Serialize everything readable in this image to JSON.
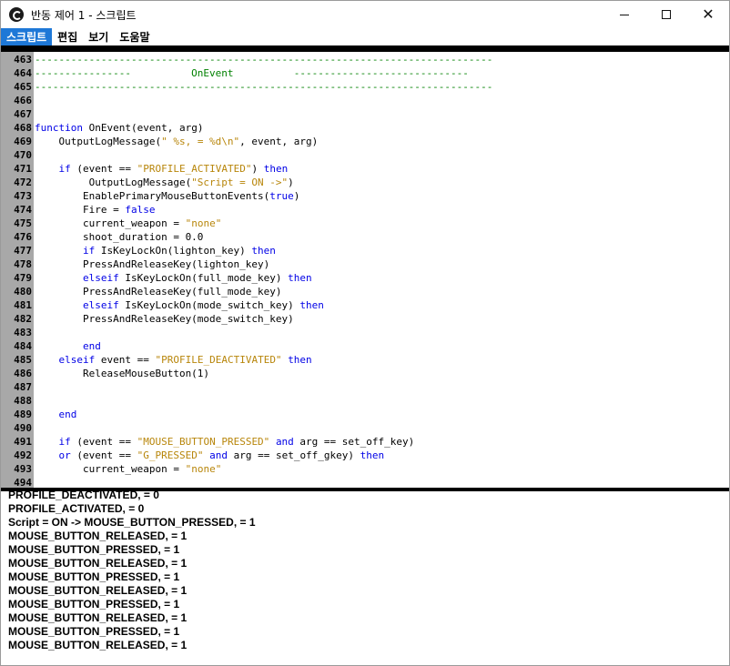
{
  "window": {
    "title": "반동 제어 1 - 스크립트"
  },
  "controls": {
    "minimize": "—",
    "maximize": "☐",
    "close": "✕"
  },
  "menu": [
    {
      "label": "스크립트",
      "active": true
    },
    {
      "label": "편집",
      "active": false
    },
    {
      "label": "보기",
      "active": false
    },
    {
      "label": "도움말",
      "active": false
    }
  ],
  "editor": {
    "lines": [
      {
        "n": "463",
        "segs": [
          [
            "cm",
            "----------------------------------------------------------------------------"
          ]
        ]
      },
      {
        "n": "464",
        "segs": [
          [
            "cm",
            "----------------          OnEvent          -----------------------------"
          ]
        ]
      },
      {
        "n": "465",
        "segs": [
          [
            "cm",
            "----------------------------------------------------------------------------"
          ]
        ]
      },
      {
        "n": "466",
        "segs": []
      },
      {
        "n": "467",
        "segs": []
      },
      {
        "n": "468",
        "segs": [
          [
            "kw",
            "function"
          ],
          [
            "",
            " OnEvent(event, arg)"
          ]
        ]
      },
      {
        "n": "469",
        "segs": [
          [
            "",
            "    OutputLogMessage("
          ],
          [
            "str",
            "\" %s, = %d\\n\""
          ],
          [
            "",
            ", event, arg)"
          ]
        ]
      },
      {
        "n": "470",
        "segs": []
      },
      {
        "n": "471",
        "segs": [
          [
            "",
            "    "
          ],
          [
            "kw",
            "if"
          ],
          [
            "",
            " (event == "
          ],
          [
            "str",
            "\"PROFILE_ACTIVATED\""
          ],
          [
            "",
            ") "
          ],
          [
            "kw",
            "then"
          ]
        ]
      },
      {
        "n": "472",
        "segs": [
          [
            "",
            "         OutputLogMessage("
          ],
          [
            "str",
            "\"Script = ON ->\""
          ],
          [
            "",
            ")"
          ]
        ]
      },
      {
        "n": "473",
        "segs": [
          [
            "",
            "        EnablePrimaryMouseButtonEvents("
          ],
          [
            "kw",
            "true"
          ],
          [
            "",
            ")"
          ]
        ]
      },
      {
        "n": "474",
        "segs": [
          [
            "",
            "        Fire = "
          ],
          [
            "kw",
            "false"
          ]
        ]
      },
      {
        "n": "475",
        "segs": [
          [
            "",
            "        current_weapon = "
          ],
          [
            "str",
            "\"none\""
          ]
        ]
      },
      {
        "n": "476",
        "segs": [
          [
            "",
            "        shoot_duration = 0.0"
          ]
        ]
      },
      {
        "n": "477",
        "segs": [
          [
            "",
            "        "
          ],
          [
            "kw",
            "if"
          ],
          [
            "",
            " IsKeyLockOn(lighton_key) "
          ],
          [
            "kw",
            "then"
          ]
        ]
      },
      {
        "n": "478",
        "segs": [
          [
            "",
            "        PressAndReleaseKey(lighton_key)"
          ]
        ]
      },
      {
        "n": "479",
        "segs": [
          [
            "",
            "        "
          ],
          [
            "kw",
            "elseif"
          ],
          [
            "",
            " IsKeyLockOn(full_mode_key) "
          ],
          [
            "kw",
            "then"
          ]
        ]
      },
      {
        "n": "480",
        "segs": [
          [
            "",
            "        PressAndReleaseKey(full_mode_key)"
          ]
        ]
      },
      {
        "n": "481",
        "segs": [
          [
            "",
            "        "
          ],
          [
            "kw",
            "elseif"
          ],
          [
            "",
            " IsKeyLockOn(mode_switch_key) "
          ],
          [
            "kw",
            "then"
          ]
        ]
      },
      {
        "n": "482",
        "segs": [
          [
            "",
            "        PressAndReleaseKey(mode_switch_key)"
          ]
        ]
      },
      {
        "n": "483",
        "segs": []
      },
      {
        "n": "484",
        "segs": [
          [
            "",
            "        "
          ],
          [
            "kw",
            "end"
          ]
        ]
      },
      {
        "n": "485",
        "segs": [
          [
            "",
            "    "
          ],
          [
            "kw",
            "elseif"
          ],
          [
            "",
            " event == "
          ],
          [
            "str",
            "\"PROFILE_DEACTIVATED\""
          ],
          [
            "",
            " "
          ],
          [
            "kw",
            "then"
          ]
        ]
      },
      {
        "n": "486",
        "segs": [
          [
            "",
            "        ReleaseMouseButton(1)"
          ]
        ]
      },
      {
        "n": "487",
        "segs": []
      },
      {
        "n": "488",
        "segs": []
      },
      {
        "n": "489",
        "segs": [
          [
            "",
            "    "
          ],
          [
            "kw",
            "end"
          ]
        ]
      },
      {
        "n": "490",
        "segs": []
      },
      {
        "n": "491",
        "segs": [
          [
            "",
            "    "
          ],
          [
            "kw",
            "if"
          ],
          [
            "",
            " (event == "
          ],
          [
            "str",
            "\"MOUSE_BUTTON_PRESSED\""
          ],
          [
            "",
            " "
          ],
          [
            "kw",
            "and"
          ],
          [
            "",
            " arg == set_off_key)"
          ]
        ]
      },
      {
        "n": "492",
        "segs": [
          [
            "",
            "    "
          ],
          [
            "kw",
            "or"
          ],
          [
            "",
            " (event == "
          ],
          [
            "str",
            "\"G_PRESSED\""
          ],
          [
            "",
            " "
          ],
          [
            "kw",
            "and"
          ],
          [
            "",
            " arg == set_off_gkey) "
          ],
          [
            "kw",
            "then"
          ]
        ]
      },
      {
        "n": "493",
        "segs": [
          [
            "",
            "        current_weapon = "
          ],
          [
            "str",
            "\"none\""
          ]
        ]
      },
      {
        "n": "494",
        "segs": []
      }
    ]
  },
  "output": {
    "lines": [
      "PROFILE_DEACTIVATED, = 0",
      "PROFILE_ACTIVATED, = 0",
      "Script = ON -> MOUSE_BUTTON_PRESSED, = 1",
      "MOUSE_BUTTON_RELEASED, = 1",
      "MOUSE_BUTTON_PRESSED, = 1",
      "MOUSE_BUTTON_RELEASED, = 1",
      "MOUSE_BUTTON_PRESSED, = 1",
      "MOUSE_BUTTON_RELEASED, = 1",
      "MOUSE_BUTTON_PRESSED, = 1",
      "MOUSE_BUTTON_RELEASED, = 1",
      "MOUSE_BUTTON_PRESSED, = 1",
      "MOUSE_BUTTON_RELEASED, = 1"
    ]
  },
  "colors": {
    "accent": "#1e78d7",
    "keyword": "#0000e6",
    "string": "#b8860b",
    "comment": "#008000",
    "gutter": "#a8a8a8"
  }
}
